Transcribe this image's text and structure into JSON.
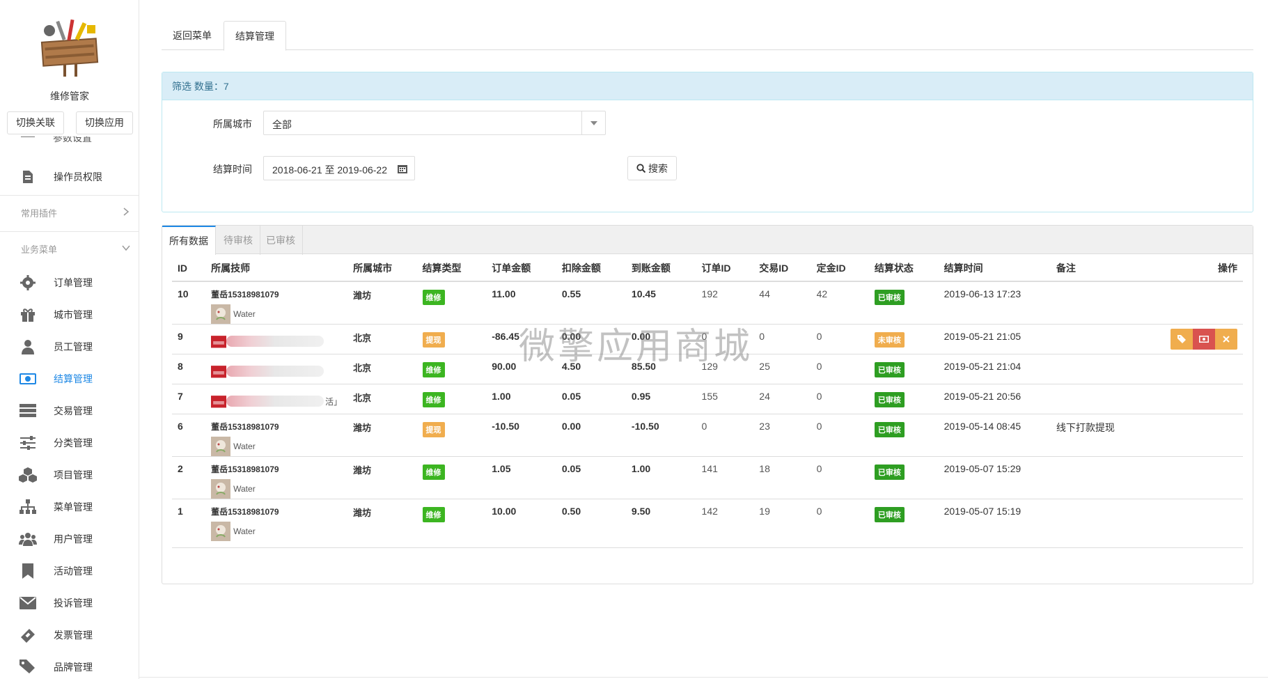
{
  "sidebar": {
    "app_name": "维修管家",
    "switch_link_label": "切换关联",
    "switch_app_label": "切换应用",
    "cut_item_label": "参数设置",
    "top_items": [
      {
        "label": "操作员权限",
        "icon": "file-edit-icon"
      }
    ],
    "sections": [
      {
        "label": "常用插件",
        "chevron": "chevron-right-icon"
      },
      {
        "label": "业务菜单",
        "chevron": "chevron-down-icon"
      }
    ],
    "items": [
      {
        "label": "订单管理",
        "icon": "gear-icon"
      },
      {
        "label": "城市管理",
        "icon": "gift-icon"
      },
      {
        "label": "员工管理",
        "icon": "user-icon"
      },
      {
        "label": "结算管理",
        "icon": "money-icon"
      },
      {
        "label": "交易管理",
        "icon": "server-icon"
      },
      {
        "label": "分类管理",
        "icon": "sliders-icon"
      },
      {
        "label": "项目管理",
        "icon": "cubes-icon"
      },
      {
        "label": "菜单管理",
        "icon": "sitemap-icon"
      },
      {
        "label": "用户管理",
        "icon": "users-icon"
      },
      {
        "label": "活动管理",
        "icon": "bookmark-icon"
      },
      {
        "label": "投诉管理",
        "icon": "envelope-icon"
      },
      {
        "label": "发票管理",
        "icon": "ticket-icon"
      },
      {
        "label": "品牌管理",
        "icon": "tags-icon"
      }
    ],
    "active_item": "结算管理"
  },
  "top_tabs": [
    "返回菜单",
    "结算管理"
  ],
  "filter": {
    "heading": "筛选 数量：7",
    "city_label": "所属城市",
    "city_value": "全部",
    "time_label": "结算时间",
    "time_value": "2018-06-21 至 2019-06-22",
    "search_label": "搜索"
  },
  "data_tabs": [
    "所有数据",
    "待审核",
    "已审核"
  ],
  "table": {
    "headers": [
      "ID",
      "所属技师",
      "所属城市",
      "结算类型",
      "订单金额",
      "扣除金额",
      "到账金额",
      "订单ID",
      "交易ID",
      "定金ID",
      "结算状态",
      "结算时间",
      "备注",
      "操作"
    ],
    "rows": [
      {
        "id": "10",
        "tech": "董岳15318981079",
        "tech_sub": "Water",
        "blurred": false,
        "city": "潍坊",
        "type": "维修",
        "type_color": "green",
        "order_amt": "11.00",
        "deduct": "0.55",
        "received": "10.45",
        "order_id": "192",
        "trade_id": "44",
        "deposit_id": "42",
        "status": "已审核",
        "status_color": "darkgreen",
        "time": "2019-06-13 17:23",
        "note": "",
        "has_ops": false
      },
      {
        "id": "9",
        "tech": "",
        "tech_sub": "",
        "blurred": true,
        "blur_tail": "",
        "city": "北京",
        "type": "提现",
        "type_color": "orange",
        "order_amt": "-86.45",
        "deduct": "0.00",
        "received": "0.00",
        "order_id": "0",
        "trade_id": "0",
        "deposit_id": "0",
        "status": "未审核",
        "status_color": "orange",
        "time": "2019-05-21 21:05",
        "note": "",
        "has_ops": true
      },
      {
        "id": "8",
        "tech": "",
        "tech_sub": "",
        "blurred": true,
        "blur_tail": "",
        "city": "北京",
        "type": "维修",
        "type_color": "green",
        "order_amt": "90.00",
        "deduct": "4.50",
        "received": "85.50",
        "order_id": "129",
        "trade_id": "25",
        "deposit_id": "0",
        "status": "已审核",
        "status_color": "darkgreen",
        "time": "2019-05-21 21:04",
        "note": "",
        "has_ops": false
      },
      {
        "id": "7",
        "tech": "",
        "tech_sub": "",
        "blurred": true,
        "blur_tail": "活」",
        "city": "北京",
        "type": "维修",
        "type_color": "green",
        "order_amt": "1.00",
        "deduct": "0.05",
        "received": "0.95",
        "order_id": "155",
        "trade_id": "24",
        "deposit_id": "0",
        "status": "已审核",
        "status_color": "darkgreen",
        "time": "2019-05-21 20:56",
        "note": "",
        "has_ops": false
      },
      {
        "id": "6",
        "tech": "董岳15318981079",
        "tech_sub": "Water",
        "blurred": false,
        "city": "潍坊",
        "type": "提现",
        "type_color": "orange",
        "order_amt": "-10.50",
        "deduct": "0.00",
        "received": "-10.50",
        "order_id": "0",
        "trade_id": "23",
        "deposit_id": "0",
        "status": "已审核",
        "status_color": "darkgreen",
        "time": "2019-05-14 08:45",
        "note": "线下打款提现",
        "has_ops": false
      },
      {
        "id": "2",
        "tech": "董岳15318981079",
        "tech_sub": "Water",
        "blurred": false,
        "city": "潍坊",
        "type": "维修",
        "type_color": "green",
        "order_amt": "1.05",
        "deduct": "0.05",
        "received": "1.00",
        "order_id": "141",
        "trade_id": "18",
        "deposit_id": "0",
        "status": "已审核",
        "status_color": "darkgreen",
        "time": "2019-05-07 15:29",
        "note": "",
        "has_ops": false
      },
      {
        "id": "1",
        "tech": "董岳15318981079",
        "tech_sub": "Water",
        "blurred": false,
        "city": "潍坊",
        "type": "维修",
        "type_color": "green",
        "order_amt": "10.00",
        "deduct": "0.50",
        "received": "9.50",
        "order_id": "142",
        "trade_id": "19",
        "deposit_id": "0",
        "status": "已审核",
        "status_color": "darkgreen",
        "time": "2019-05-07 15:19",
        "note": "",
        "has_ops": false
      }
    ],
    "row_ops": [
      {
        "icon": "tag-icon",
        "color": "#f0ad4e"
      },
      {
        "icon": "money-icon",
        "color": "#d9534f"
      },
      {
        "icon": "close-icon",
        "color": "#f0ad4e"
      }
    ]
  },
  "watermark": "微擎应用商城",
  "colors": {
    "accent": "#1e88e5",
    "info_bg": "#d9edf7",
    "info_text": "#31708f",
    "green": "#3cb521",
    "orange": "#f0ad4e",
    "red": "#d9534f"
  }
}
